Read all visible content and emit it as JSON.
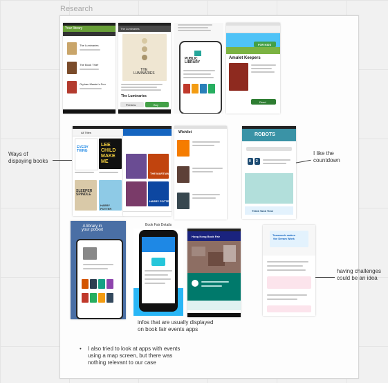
{
  "frame": {
    "title": "Research"
  },
  "notes": {
    "ways": "Ways of\ndispaying books",
    "countdown": "I like the\ncountdown",
    "challenges": "having challenges\ncould be an idea",
    "infos": "infos that are usually displayed\non book fair events apps",
    "map_bullet": "I also tried to look at apps with events\nusing a map screen, but there was\nnothing relevant to our case"
  },
  "screens": {
    "library": {
      "header": "Your library",
      "items": [
        "The Luminaries",
        "The Book Thief",
        "Orphan Master's Son"
      ]
    },
    "luminaries": {
      "header": "The Luminaries",
      "cover_title": "THE\nLUMINARIES",
      "book_title": "The Luminaries",
      "preview": "Preview",
      "buy": "Buy"
    },
    "public_library": {
      "logo": "PUBLIC\nLIBRARY"
    },
    "amulet": {
      "banner": "FOR KIDS",
      "title": "Amulet Keepers",
      "button": "Read"
    },
    "bookshelf": {
      "tab": "All Titles",
      "covers": [
        "EVERY THING",
        "LEE CHILD MAKE ME",
        "SLEEPER SPINDLE",
        "HARRY POTTER"
      ]
    },
    "bookcovers": {
      "titles": [
        "THE MARTIAN",
        "HARRY POTTER"
      ]
    },
    "wishlist": {
      "header": "Wishlist"
    },
    "robots": {
      "header": "ROBOTS",
      "countdown": [
        "0",
        "2"
      ],
      "button": "Think Tank Time"
    },
    "library_pocket": {
      "headline": "A library in\nyour pocket"
    },
    "book_fair": {
      "caption": "Book Fair Details"
    },
    "hk_fair": {
      "header": "Hong Kong Book Fair"
    },
    "teamwork": {
      "heading": "Teamwork makes\nthe Dream Work"
    }
  }
}
